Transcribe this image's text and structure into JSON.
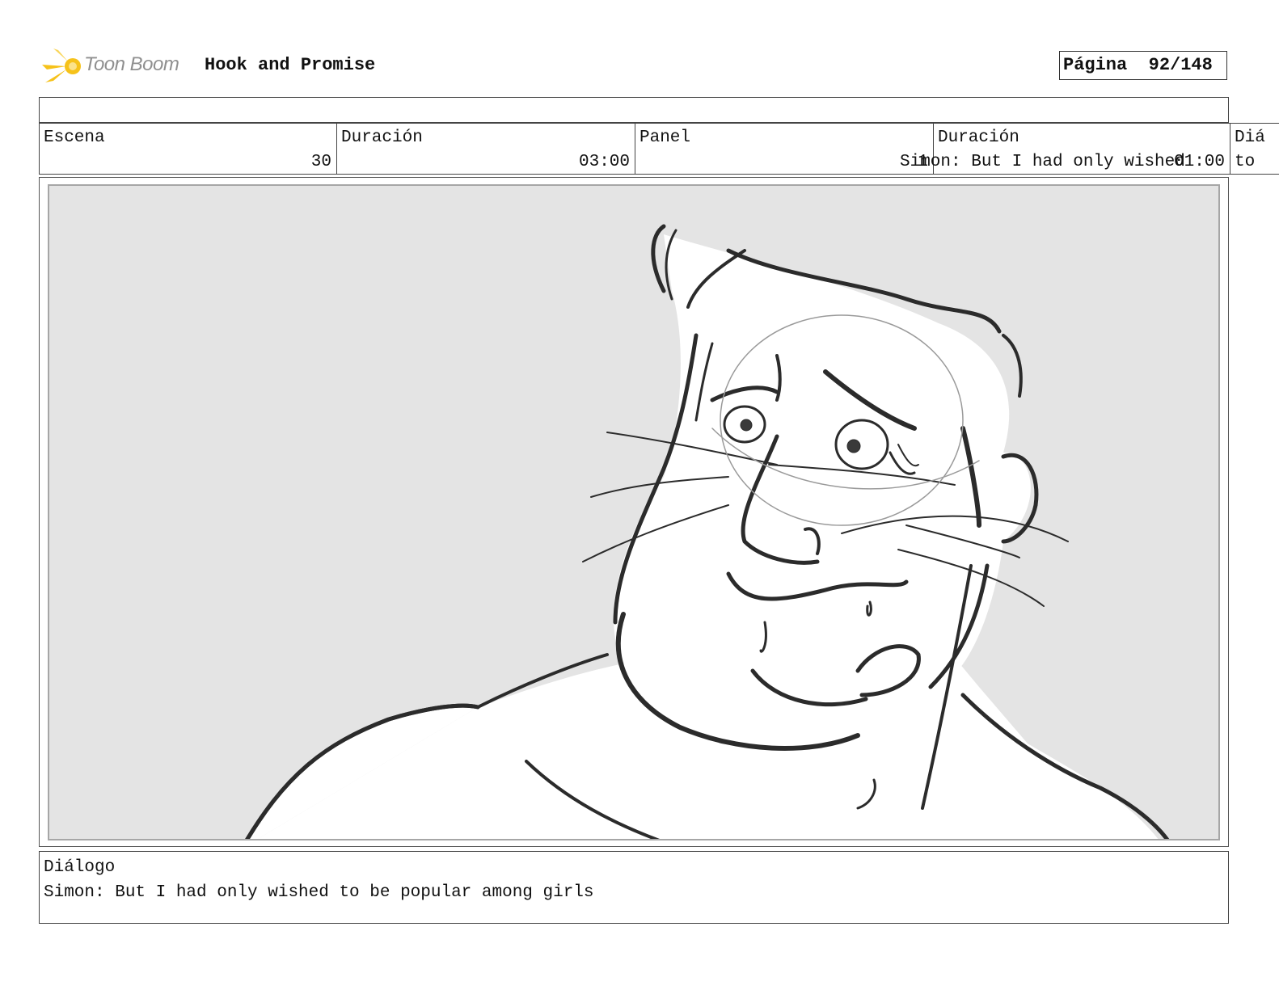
{
  "header": {
    "logo_text": "Toon Boom",
    "project_title": "Hook and Promise",
    "page_label": "Página",
    "page_number": "92/148"
  },
  "info": {
    "scene_label": "Escena",
    "scene_value": "30",
    "scene_duration_label": "Duración",
    "scene_duration_value": "03:00",
    "panel_label": "Panel",
    "panel_value": "1",
    "panel_overflow_text": "Simon: But I had only wished",
    "panel_duration_label": "Duración",
    "panel_duration_value": "01:00",
    "dialog_col_label": "Diá",
    "dialog_col_overflow": "to"
  },
  "panel_image": {
    "subject": "storyboard sketch of a worried cat character",
    "background_color": "#e4e4e4"
  },
  "dialog": {
    "label": "Diálogo",
    "text": "Simon: But I had only wished to be popular among girls"
  },
  "colors": {
    "logo_accent": "#f6c21a",
    "logo_text": "#8f8f8f",
    "sketch_stroke": "#2b2b2b"
  },
  "icons": [
    "toon-boom-logo-icon"
  ]
}
